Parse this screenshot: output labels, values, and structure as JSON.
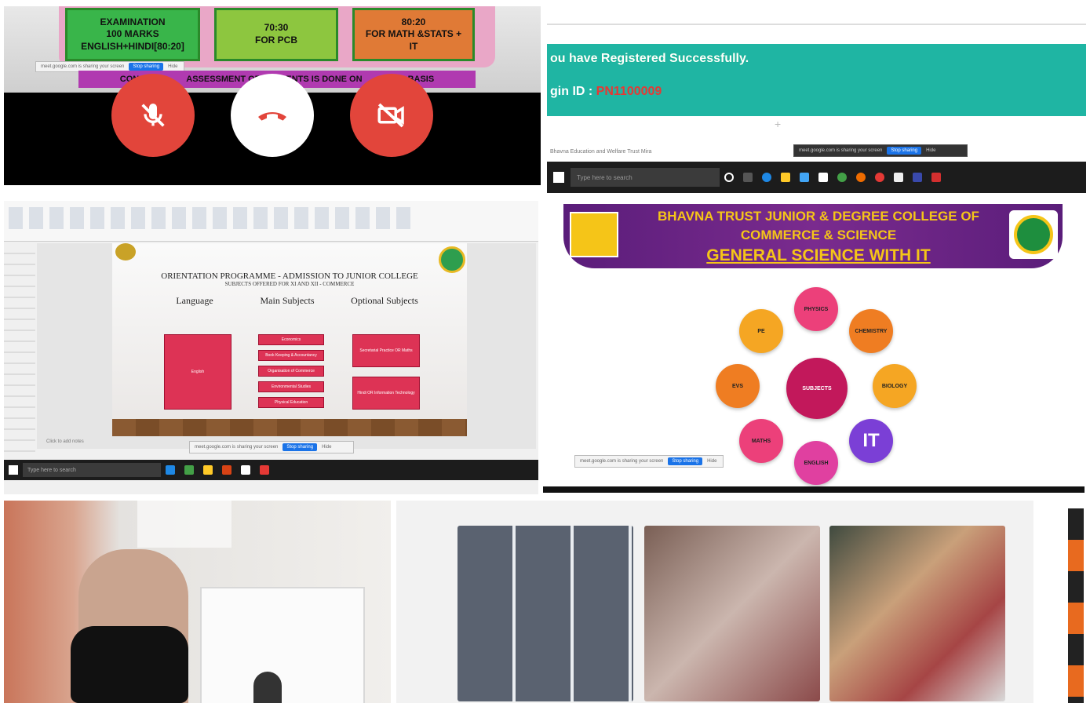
{
  "call_panel": {
    "boxes": [
      {
        "line1": "EXAMINATION",
        "line2": "100 MARKS",
        "line3": "ENGLISH+HINDI[80:20]"
      },
      {
        "line1": "70:30",
        "line2": "FOR PCB",
        "line3": ""
      },
      {
        "line1": "80:20",
        "line2": "FOR MATH &STATS +",
        "line3": "IT"
      }
    ],
    "ribbon_left": "CON",
    "ribbon_right": "ASSESSMENT OF STUDENTS IS DONE ON",
    "ribbon_end": "BASIS",
    "share_text": "meet.google.com is sharing your screen",
    "share_stop": "Stop sharing",
    "share_hide": "Hide",
    "buttons": {
      "mic": "mic-off",
      "end": "end-call",
      "camera": "camera-off"
    },
    "colors": {
      "red": "#e2453b",
      "white": "#ffffff"
    }
  },
  "registration_panel": {
    "message": "ou have Registered Successfully.",
    "login_label": "gin ID :",
    "login_id": "PN1100009",
    "small_text": "Bhavna Education and Welfare Trust Mira",
    "share_text": "meet.google.com is sharing your screen",
    "share_stop": "Stop sharing",
    "share_hide": "Hide",
    "search_placeholder": "Type here to search"
  },
  "ppt_panel": {
    "title": "ORIENTATION PROGRAMME - ADMISSION TO JUNIOR COLLEGE",
    "subtitle": "SUBJECTS OFFERED FOR XI AND XII - COMMERCE",
    "columns": [
      {
        "head": "Language",
        "items": [
          "English"
        ]
      },
      {
        "head": "Main Subjects",
        "items": [
          "Economics",
          "Book Keeping & Accountancy",
          "Organisation of Commerce",
          "Environmental Studies",
          "Physical Education"
        ]
      },
      {
        "head": "Optional Subjects",
        "items": [
          "Secretarial Practice OR Maths",
          "Hindi OR Information Technology"
        ]
      }
    ],
    "notes": "Click to add notes",
    "share_text": "meet.google.com is sharing your screen",
    "share_stop": "Stop sharing",
    "share_hide": "Hide",
    "search_placeholder": "Type here to search"
  },
  "science_panel": {
    "header1": "BHAVNA TRUST JUNIOR & DEGREE COLLEGE OF",
    "header2": "COMMERCE & SCIENCE",
    "header3": "GENERAL SCIENCE WITH IT",
    "center": "SUBJECTS",
    "subjects": [
      "PHYSICS",
      "CHEMISTRY",
      "BIOLOGY",
      "IT",
      "ENGLISH",
      "MATHS",
      "EVS",
      "PE"
    ],
    "share_text": "meet.google.com is sharing your screen",
    "share_stop": "Stop sharing",
    "share_hide": "Hide"
  }
}
